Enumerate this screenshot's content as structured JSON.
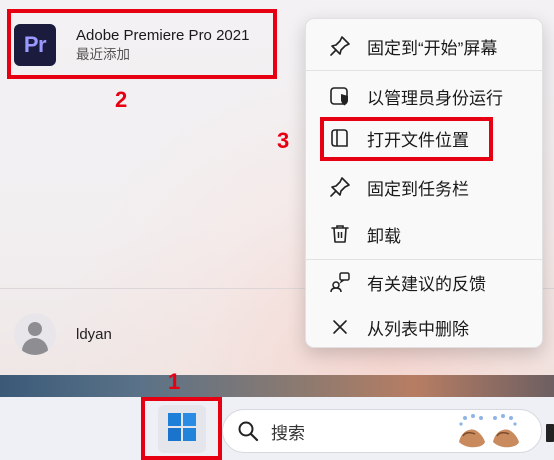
{
  "recent_app": {
    "name": "Adobe Premiere Pro 2021",
    "subtitle": "最近添加",
    "icon_text": "Pr",
    "icon": "premiere-pro-icon"
  },
  "user": {
    "name": "ldyan",
    "icon": "user-avatar-icon"
  },
  "context_menu": {
    "items": [
      {
        "label": "固定到“开始”屏幕",
        "icon": "pin-icon"
      },
      {
        "label": "以管理员身份运行",
        "icon": "admin-shield-icon"
      },
      {
        "label": "打开文件位置",
        "icon": "file-location-icon"
      },
      {
        "label": "固定到任务栏",
        "icon": "pin-taskbar-icon"
      },
      {
        "label": "卸载",
        "icon": "trash-icon"
      },
      {
        "label": "有关建议的反馈",
        "icon": "feedback-icon"
      },
      {
        "label": "从列表中删除",
        "icon": "close-icon"
      }
    ]
  },
  "taskbar": {
    "start_icon": "windows-logo-icon",
    "search_label": "搜索",
    "search_icon": "search-icon"
  },
  "annotations": {
    "step1": "1",
    "step2": "2",
    "step3": "3",
    "color": "#e60012"
  }
}
